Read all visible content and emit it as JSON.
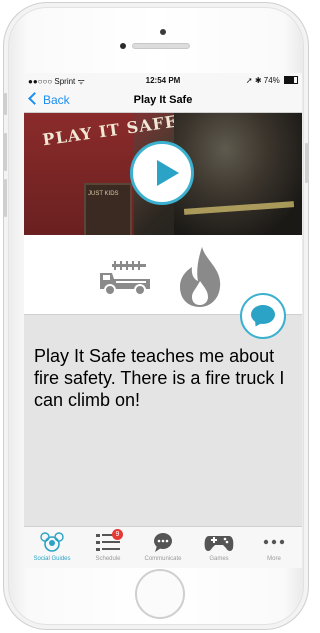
{
  "status_bar": {
    "carrier": "●●○○○ Sprint ᯤ",
    "time": "12:54 PM",
    "battery": "➚ ✱ 74%"
  },
  "nav": {
    "back_label": "Back",
    "title": "Play It Safe"
  },
  "hero": {
    "sign_text": "PLAY IT SAFE",
    "door_label": "JUST KIDS",
    "play_icon": "play-icon"
  },
  "description": "Play It Safe teaches me about fire safety. There is a fire truck I can climb on!",
  "tabs": [
    {
      "label": "Social Guides",
      "icon": "social-guides-icon",
      "active": true
    },
    {
      "label": "Schedule",
      "icon": "schedule-icon",
      "badge": "9"
    },
    {
      "label": "Communicate",
      "icon": "communicate-icon"
    },
    {
      "label": "Games",
      "icon": "gamepad-icon"
    },
    {
      "label": "More",
      "icon": "more-icon"
    }
  ],
  "colors": {
    "accent": "#2aa3c6",
    "link": "#1a8ef0",
    "badge": "#e53935"
  }
}
